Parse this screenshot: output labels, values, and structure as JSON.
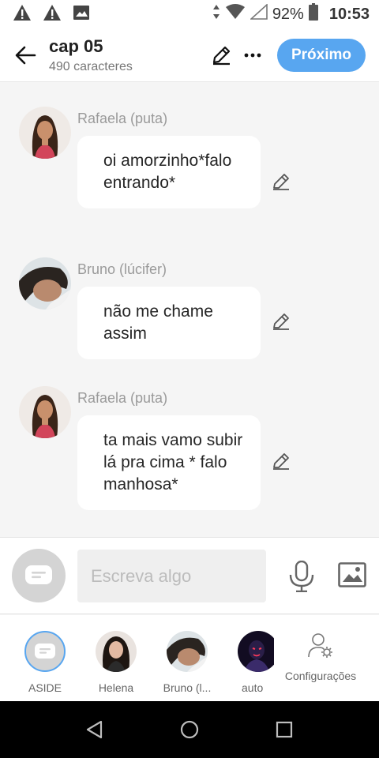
{
  "status_bar": {
    "battery_percent": "92%",
    "time": "10:53"
  },
  "header": {
    "title": "cap 05",
    "subtitle": "490 caracteres",
    "next_label": "Próximo"
  },
  "messages": [
    {
      "sender": "Rafaela (puta)",
      "text": "oi amorzinho*falo entrando*"
    },
    {
      "sender": "Bruno (lúcifer)",
      "text": "não me chame assim"
    },
    {
      "sender": "Rafaela (puta)",
      "text": "ta mais vamo subir lá pra cima * falo manhosa*"
    }
  ],
  "composer": {
    "placeholder": "Escreva algo"
  },
  "characters": [
    {
      "label": "ASIDE"
    },
    {
      "label": "Helena"
    },
    {
      "label": "Bruno (l..."
    },
    {
      "label": "auto"
    }
  ],
  "settings_label": "Configurações",
  "colors": {
    "accent": "#58a6f0",
    "background": "#f5f5f5"
  }
}
